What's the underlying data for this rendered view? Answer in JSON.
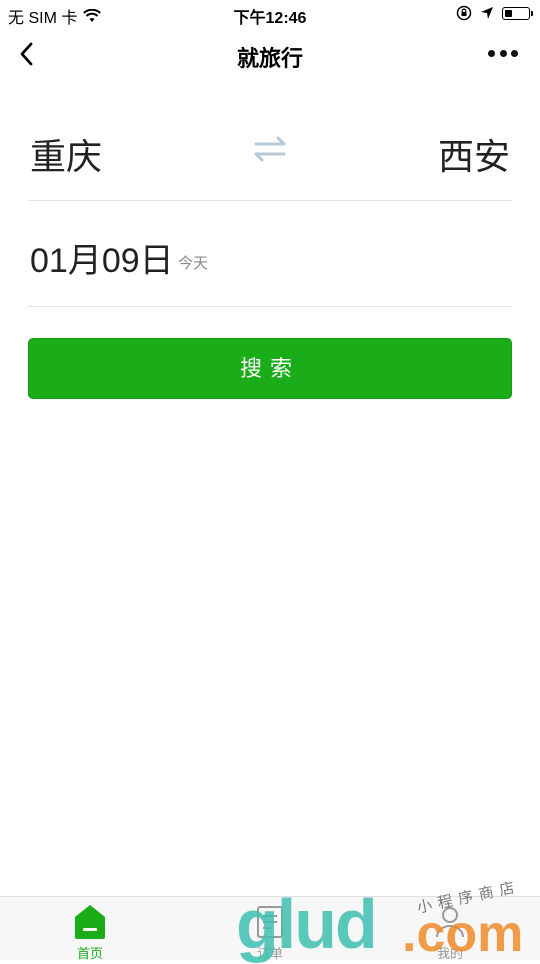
{
  "status_bar": {
    "carrier": "无 SIM 卡",
    "time": "下午12:46",
    "battery_level": 0.25,
    "icons": [
      "wifi-icon",
      "orientation-lock-icon",
      "location-arrow-icon",
      "battery-icon"
    ]
  },
  "nav": {
    "title": "就旅行",
    "back_icon": "chevron-left-icon",
    "more_icon": "more-dots-icon"
  },
  "route": {
    "from": "重庆",
    "to": "西安",
    "swap_icon": "swap-arrows-icon"
  },
  "date": {
    "value": "01月09日",
    "hint": "今天"
  },
  "search": {
    "label": "搜索"
  },
  "tabs": [
    {
      "label": "首页",
      "icon": "home-icon",
      "active": true
    },
    {
      "label": "订单",
      "icon": "orders-icon",
      "active": false
    },
    {
      "label": "我的",
      "icon": "profile-icon",
      "active": false
    }
  ],
  "watermark": {
    "brand": "glud",
    "domain": ".com",
    "tagline": "小程序商店"
  },
  "colors": {
    "accent": "#1aad19",
    "swap_icon": "#b9c8d6",
    "divider": "#e3e3e3",
    "tab_inactive": "#999999"
  }
}
